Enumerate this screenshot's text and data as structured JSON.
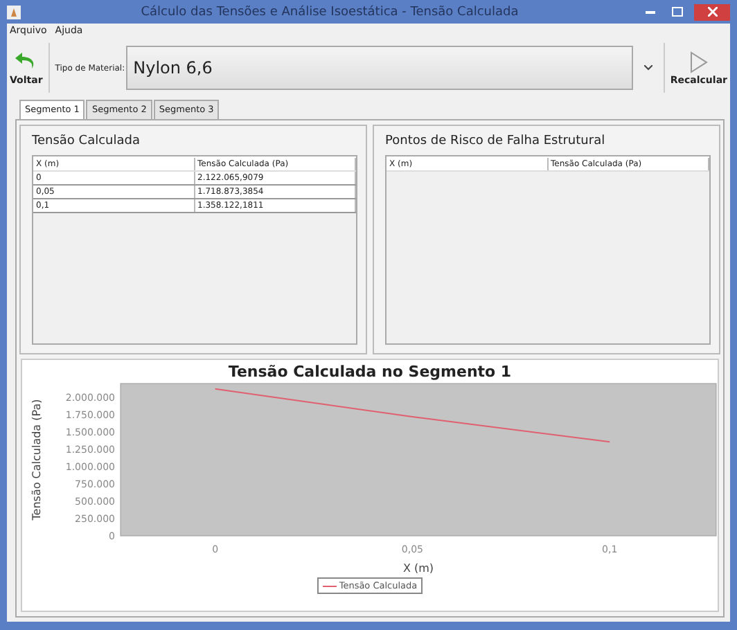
{
  "window": {
    "title": "Cálculo das Tensões e Análise Isoestática - Tensão Calculada"
  },
  "menu": [
    "Arquivo",
    "Ajuda"
  ],
  "toolbar": {
    "back_button": "Voltar",
    "material_label": "Tipo de Material:",
    "material_value": "Nylon 6,6",
    "recalc_button": "Recalcular"
  },
  "tabs": [
    {
      "label": "Segmento 1",
      "selected": true
    },
    {
      "label": "Segmento 2",
      "selected": false
    },
    {
      "label": "Segmento 3",
      "selected": false
    }
  ],
  "stress_panel": {
    "title": "Tensão Calculada",
    "columns": [
      "X (m)",
      "Tensão Calculada (Pa)"
    ],
    "rows": [
      [
        "0",
        "2.122.065,9079"
      ],
      [
        "0,05",
        "1.718.873,3854"
      ],
      [
        "0,1",
        "1.358.122,1811"
      ]
    ]
  },
  "risk_panel": {
    "title": "Pontos de Risco de Falha Estrutural",
    "columns": [
      "X (m)",
      "Tensão Calculada (Pa)"
    ]
  },
  "chart": {
    "chart_data": {
      "type": "line",
      "title": "Tensão Calculada no Segmento 1",
      "xlabel": "X (m)",
      "ylabel": "Tensão Calculada (Pa)",
      "x": [
        0,
        0.05,
        0.1
      ],
      "series": [
        {
          "name": "Tensão Calculada",
          "color": "#e06070",
          "values": [
            2122000,
            1719000,
            1358000
          ]
        }
      ],
      "xlim": [
        -0.024,
        0.127
      ],
      "ylim": [
        0,
        2200000
      ],
      "xticks": [
        {
          "value": 0,
          "label": "0"
        },
        {
          "value": 0.05,
          "label": "0,05"
        },
        {
          "value": 0.1,
          "label": "0,1"
        }
      ],
      "yticks": [
        {
          "value": 0,
          "label": "0"
        },
        {
          "value": 250000,
          "label": "250.000"
        },
        {
          "value": 500000,
          "label": "500.000"
        },
        {
          "value": 750000,
          "label": "750.000"
        },
        {
          "value": 1000000,
          "label": "1.000.000"
        },
        {
          "value": 1250000,
          "label": "1.250.000"
        },
        {
          "value": 1500000,
          "label": "1.500.000"
        },
        {
          "value": 1750000,
          "label": "1.750.000"
        },
        {
          "value": 2000000,
          "label": "2.000.000"
        }
      ]
    }
  }
}
